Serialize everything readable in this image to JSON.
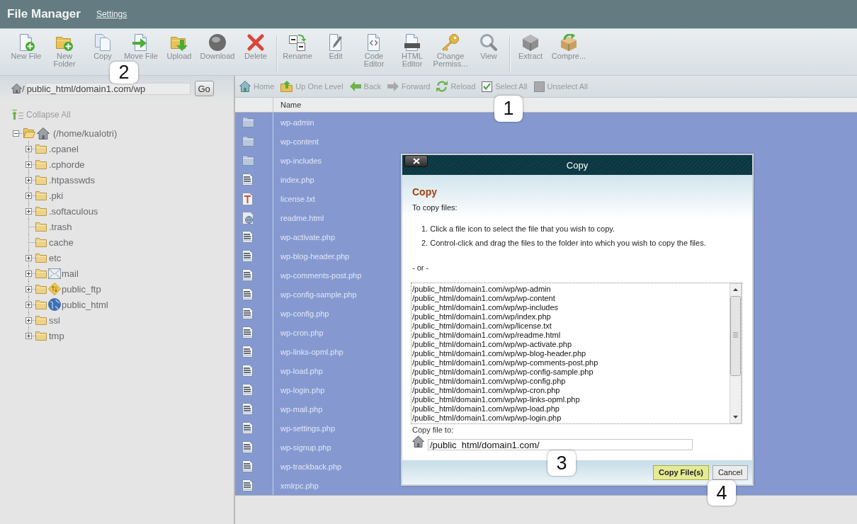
{
  "header": {
    "title": "File Manager",
    "settings_link": "Settings"
  },
  "toolbar": [
    {
      "buttons": [
        {
          "label": "New File",
          "kind": "newfile"
        },
        {
          "label": "New Folder",
          "kind": "newfolder"
        },
        {
          "label": "Copy",
          "kind": "copy"
        },
        {
          "label": "Move File",
          "kind": "move"
        },
        {
          "label": "Upload",
          "kind": "upload"
        },
        {
          "label": "Download",
          "kind": "download"
        },
        {
          "label": "Delete",
          "kind": "delete"
        }
      ]
    },
    {
      "buttons": [
        {
          "label": "Rename",
          "kind": "rename"
        },
        {
          "label": "Edit",
          "kind": "edit"
        },
        {
          "label": "Code Editor",
          "kind": "code"
        },
        {
          "label": "HTML Editor",
          "kind": "html"
        },
        {
          "label": "Change Permiss...",
          "kind": "permissions"
        },
        {
          "label": "View",
          "kind": "view"
        }
      ]
    },
    {
      "buttons": [
        {
          "label": "Extract",
          "kind": "extract"
        },
        {
          "label": "Compre...",
          "kind": "compress"
        }
      ]
    }
  ],
  "path_bar": {
    "prefix": "/",
    "value": "public_html/domain1.com/wp",
    "button": "Go"
  },
  "folder_tree": {
    "collapse_all": "Collapse All",
    "root": {
      "label": "(/home/kualotri)",
      "kind": "home",
      "expandable": true,
      "expanded": true,
      "children": [
        {
          "label": ".cpanel",
          "kind": "folder",
          "expandable": true
        },
        {
          "label": ".cphorde",
          "kind": "folder",
          "expandable": true
        },
        {
          "label": ".htpasswds",
          "kind": "folder",
          "expandable": true
        },
        {
          "label": ".pki",
          "kind": "folder",
          "expandable": true
        },
        {
          "label": ".softaculous",
          "kind": "folder",
          "expandable": true
        },
        {
          "label": ".trash",
          "kind": "folder",
          "expandable": false
        },
        {
          "label": "cache",
          "kind": "folder",
          "expandable": false
        },
        {
          "label": "etc",
          "kind": "folder",
          "expandable": true
        },
        {
          "label": "mail",
          "kind": "mail",
          "expandable": true
        },
        {
          "label": "public_ftp",
          "kind": "ftp",
          "expandable": true
        },
        {
          "label": "public_html",
          "kind": "web",
          "expandable": true
        },
        {
          "label": "ssl",
          "kind": "folder",
          "expandable": true
        },
        {
          "label": "tmp",
          "kind": "folder",
          "expandable": true
        }
      ]
    }
  },
  "nav_bar": [
    {
      "label": "Home",
      "kind": "home"
    },
    {
      "label": "Up One Level",
      "kind": "up"
    },
    {
      "label": "Back",
      "kind": "back"
    },
    {
      "label": "Forward",
      "kind": "forward"
    },
    {
      "label": "Reload",
      "kind": "reload"
    },
    {
      "label": "Select All",
      "kind": "checkbox",
      "checked": true
    },
    {
      "label": "Unselect All",
      "kind": "checkbox",
      "checked": false
    }
  ],
  "file_table": {
    "columns": [
      "Name"
    ],
    "rows": [
      {
        "name": "wp-admin",
        "kind": "folder",
        "selected": true
      },
      {
        "name": "wp-content",
        "kind": "folder",
        "selected": true
      },
      {
        "name": "wp-includes",
        "kind": "folder",
        "selected": true
      },
      {
        "name": "index.php",
        "kind": "php",
        "selected": true
      },
      {
        "name": "license.txt",
        "kind": "text",
        "selected": true
      },
      {
        "name": "readme.html",
        "kind": "html",
        "selected": true
      },
      {
        "name": "wp-activate.php",
        "kind": "php",
        "selected": true
      },
      {
        "name": "wp-blog-header.php",
        "kind": "php",
        "selected": true
      },
      {
        "name": "wp-comments-post.php",
        "kind": "php",
        "selected": true
      },
      {
        "name": "wp-config-sample.php",
        "kind": "php",
        "selected": true
      },
      {
        "name": "wp-config.php",
        "kind": "php",
        "selected": true
      },
      {
        "name": "wp-cron.php",
        "kind": "php",
        "selected": true
      },
      {
        "name": "wp-links-opml.php",
        "kind": "php",
        "selected": true
      },
      {
        "name": "wp-load.php",
        "kind": "php",
        "selected": true
      },
      {
        "name": "wp-login.php",
        "kind": "php",
        "selected": true
      },
      {
        "name": "wp-mail.php",
        "kind": "php",
        "selected": true
      },
      {
        "name": "wp-settings.php",
        "kind": "php",
        "selected": true
      },
      {
        "name": "wp-signup.php",
        "kind": "php",
        "selected": true
      },
      {
        "name": "wp-trackback.php",
        "kind": "php",
        "selected": true
      },
      {
        "name": "xmlrpc.php",
        "kind": "php",
        "selected": true
      }
    ]
  },
  "copy_dialog": {
    "title": "Copy",
    "heading": "Copy",
    "intro": "To copy files:",
    "steps": [
      "1. Click a file icon to select the file that you wish to copy.",
      "2. Control-click and drag the files to the folder into which you wish to copy the files."
    ],
    "separator": "- or -",
    "selected_files": [
      "/public_html/domain1.com/wp/wp-admin",
      "/public_html/domain1.com/wp/wp-content",
      "/public_html/domain1.com/wp/wp-includes",
      "/public_html/domain1.com/wp/index.php",
      "/public_html/domain1.com/wp/license.txt",
      "/public_html/domain1.com/wp/readme.html",
      "/public_html/domain1.com/wp/wp-activate.php",
      "/public_html/domain1.com/wp/wp-blog-header.php",
      "/public_html/domain1.com/wp/wp-comments-post.php",
      "/public_html/domain1.com/wp/wp-config-sample.php",
      "/public_html/domain1.com/wp/wp-config.php",
      "/public_html/domain1.com/wp/wp-cron.php",
      "/public_html/domain1.com/wp/wp-links-opml.php",
      "/public_html/domain1.com/wp/wp-load.php",
      "/public_html/domain1.com/wp/wp-login.php"
    ],
    "destination_label": "Copy file to:",
    "destination_value": "/public_html/domain1.com/",
    "buttons": [
      {
        "label": "Copy File(s)",
        "kind": "primary"
      },
      {
        "label": "Cancel",
        "kind": "secondary"
      }
    ]
  },
  "callouts": [
    {
      "label": "1"
    },
    {
      "label": "2"
    },
    {
      "label": "3"
    },
    {
      "label": "4"
    }
  ]
}
